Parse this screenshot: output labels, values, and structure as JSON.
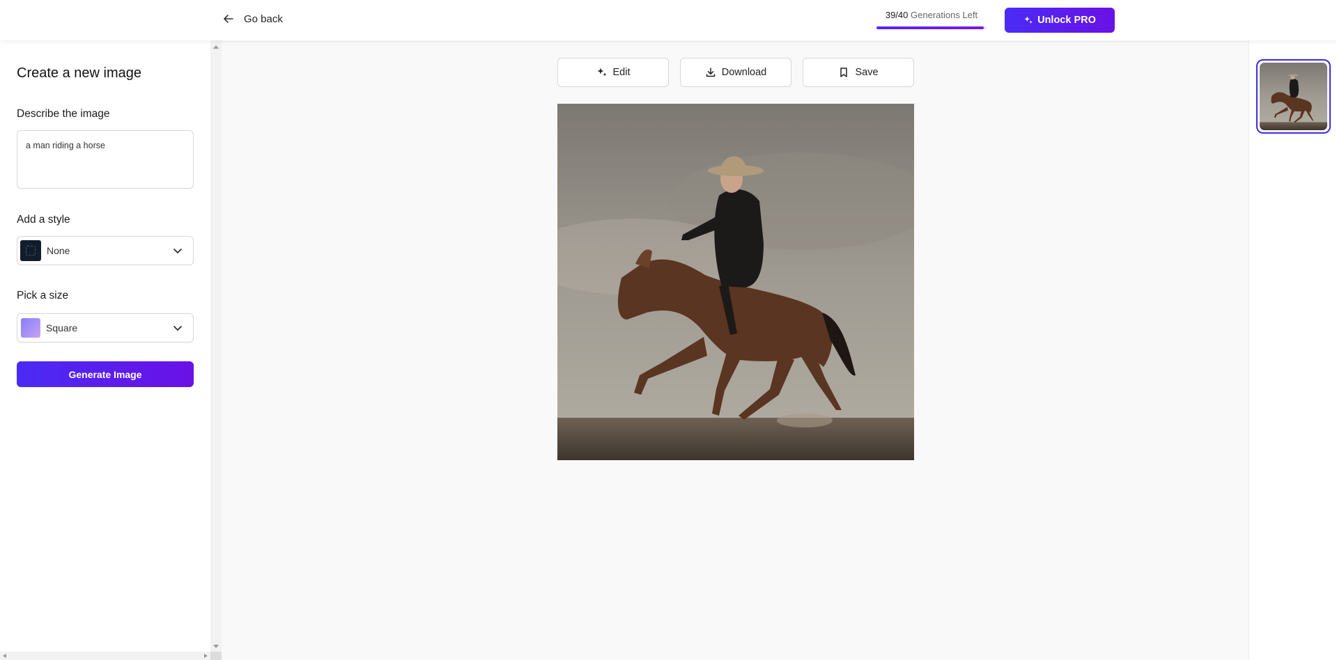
{
  "header": {
    "back_label": "Go back",
    "generations_count": "39/40",
    "generations_label": "Generations Left",
    "generations_fraction": 0.975,
    "unlock_label": "Unlock PRO"
  },
  "sidebar": {
    "title": "Create a new image",
    "describe_label": "Describe the image",
    "describe_value": "a man riding a horse",
    "style_label": "Add a style",
    "style_value": "None",
    "size_label": "Pick a size",
    "size_value": "Square",
    "generate_label": "Generate Image"
  },
  "toolbar": {
    "edit_label": "Edit",
    "download_label": "Download",
    "save_label": "Save"
  },
  "colors": {
    "accent": "#4a2bf5",
    "accent_end": "#6a11e6",
    "thumb_border": "#3b2ae8"
  }
}
